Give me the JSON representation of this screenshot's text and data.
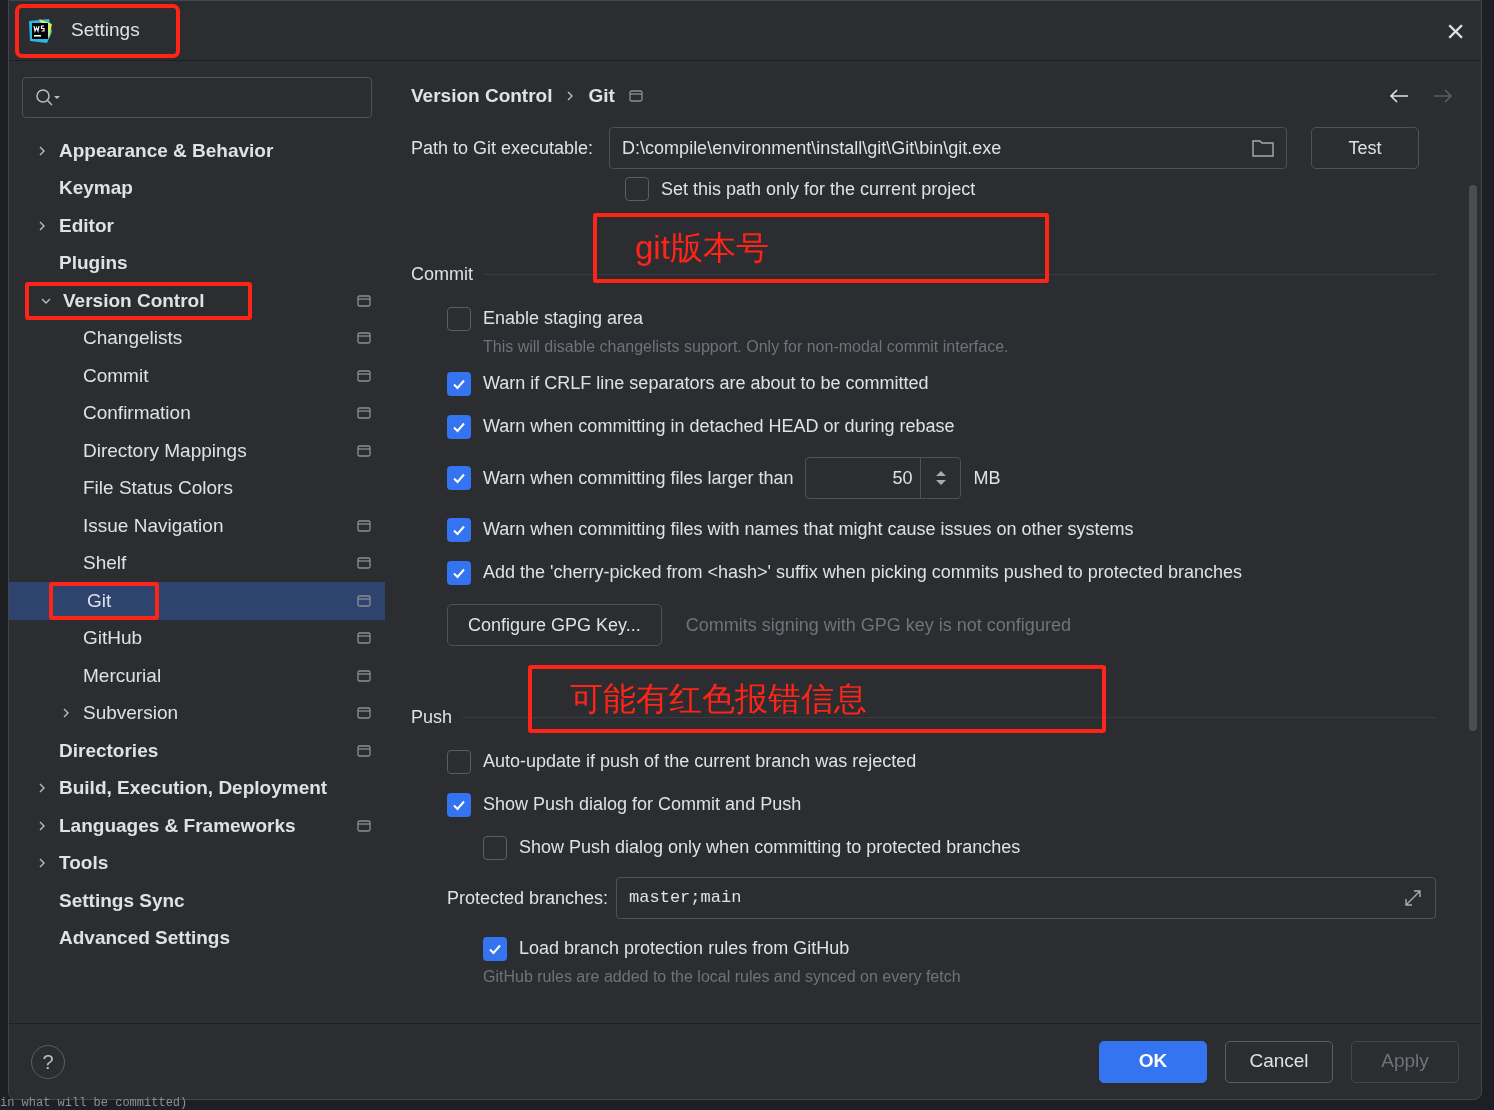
{
  "window": {
    "title": "Settings",
    "annotated": true,
    "close": "×"
  },
  "sidebar": {
    "items": [
      {
        "label": "Appearance & Behavior",
        "bold": true,
        "expanded": false,
        "selected": false,
        "annotated": false,
        "scoped": false
      },
      {
        "label": "Keymap",
        "bold": true,
        "selected": false,
        "annotated": false,
        "scoped": false
      },
      {
        "label": "Editor",
        "bold": true,
        "expanded": false,
        "selected": false,
        "annotated": false,
        "scoped": false
      },
      {
        "label": "Plugins",
        "bold": true,
        "selected": false,
        "annotated": false,
        "scoped": false
      },
      {
        "label": "Version Control",
        "bold": true,
        "expanded": true,
        "selected": false,
        "annotated": true,
        "scoped": true,
        "children": [
          {
            "label": "Changelists",
            "bold": false,
            "selected": false,
            "annotated": false,
            "scoped": true
          },
          {
            "label": "Commit",
            "bold": false,
            "selected": false,
            "annotated": false,
            "scoped": true
          },
          {
            "label": "Confirmation",
            "bold": false,
            "selected": false,
            "annotated": false,
            "scoped": true
          },
          {
            "label": "Directory Mappings",
            "bold": false,
            "selected": false,
            "annotated": false,
            "scoped": true
          },
          {
            "label": "File Status Colors",
            "bold": false,
            "selected": false,
            "annotated": false,
            "scoped": false
          },
          {
            "label": "Issue Navigation",
            "bold": false,
            "selected": false,
            "annotated": false,
            "scoped": true
          },
          {
            "label": "Shelf",
            "bold": false,
            "selected": false,
            "annotated": false,
            "scoped": true
          },
          {
            "label": "Git",
            "bold": false,
            "selected": true,
            "annotated": true,
            "scoped": true
          },
          {
            "label": "GitHub",
            "bold": false,
            "selected": false,
            "annotated": false,
            "scoped": true
          },
          {
            "label": "Mercurial",
            "bold": false,
            "selected": false,
            "annotated": false,
            "scoped": true
          },
          {
            "label": "Subversion",
            "bold": false,
            "expanded": false,
            "selected": false,
            "annotated": false,
            "scoped": true
          }
        ]
      },
      {
        "label": "Directories",
        "bold": true,
        "selected": false,
        "annotated": false,
        "scoped": true
      },
      {
        "label": "Build, Execution, Deployment",
        "bold": true,
        "expanded": false,
        "selected": false,
        "annotated": false,
        "scoped": false
      },
      {
        "label": "Languages & Frameworks",
        "bold": true,
        "expanded": false,
        "selected": false,
        "annotated": false,
        "scoped": true
      },
      {
        "label": "Tools",
        "bold": true,
        "expanded": false,
        "selected": false,
        "annotated": false,
        "scoped": false
      },
      {
        "label": "Settings Sync",
        "bold": true,
        "selected": false,
        "annotated": false,
        "scoped": false
      },
      {
        "label": "Advanced Settings",
        "bold": true,
        "selected": false,
        "annotated": false,
        "scoped": false
      }
    ]
  },
  "breadcrumb": [
    "Version Control",
    "Git"
  ],
  "path": {
    "label": "Path to Git executable:",
    "value": "D:\\compile\\environment\\install\\git\\Git\\bin\\git.exe",
    "button": "Test",
    "checkbox": {
      "label": "Set this path only for the current project",
      "checked": false
    }
  },
  "sections": [
    {
      "title": "Commit",
      "items": [
        {
          "kind": "checkbox",
          "label": "Enable staging area",
          "checked": false,
          "children": [
            {
              "kind": "hint",
              "text": "This will disable changelists support. Only for non-modal commit interface."
            }
          ]
        },
        {
          "kind": "checkbox",
          "label": "Warn if CRLF line separators are about to be committed",
          "checked": true
        },
        {
          "kind": "checkbox",
          "label": "Warn when committing in detached HEAD or during rebase",
          "checked": true
        },
        {
          "kind": "number",
          "label": "Warn when committing files larger than",
          "checked": true,
          "value": "50",
          "unit": "MB"
        },
        {
          "kind": "checkbox",
          "label": "Warn when committing files with names that might cause issues on other systems",
          "checked": true
        },
        {
          "kind": "checkbox",
          "label": "Add the 'cherry-picked from <hash>' suffix when picking commits pushed to protected branches",
          "checked": true
        },
        {
          "kind": "button",
          "label": "Configure GPG Key...",
          "note": "Commits signing with GPG key is not configured"
        }
      ]
    },
    {
      "title": "Push",
      "items": [
        {
          "kind": "checkbox",
          "label": "Auto-update if push of the current branch was rejected",
          "checked": false
        },
        {
          "kind": "checkbox",
          "label": "Show Push dialog for Commit and Push",
          "checked": true,
          "children": [
            {
              "kind": "checkbox",
              "label": "Show Push dialog only when committing to protected branches",
              "checked": false
            }
          ]
        },
        {
          "kind": "field",
          "label": "Protected branches:",
          "value": "master;main",
          "children": [
            {
              "kind": "checkbox",
              "label": "Load branch protection rules from GitHub",
              "checked": true
            },
            {
              "kind": "hint",
              "text": "GitHub rules are added to the local rules and synced on every fetch"
            }
          ]
        }
      ]
    }
  ],
  "annotations": [
    {
      "text": "git版本号"
    },
    {
      "text": "可能有红色报错信息"
    }
  ],
  "footer": {
    "help": "?",
    "buttons": [
      {
        "label": "OK",
        "kind": "primary"
      },
      {
        "label": "Cancel",
        "kind": "normal"
      },
      {
        "label": "Apply",
        "kind": "disabled"
      }
    ]
  },
  "background_text": "in what will be committed)"
}
